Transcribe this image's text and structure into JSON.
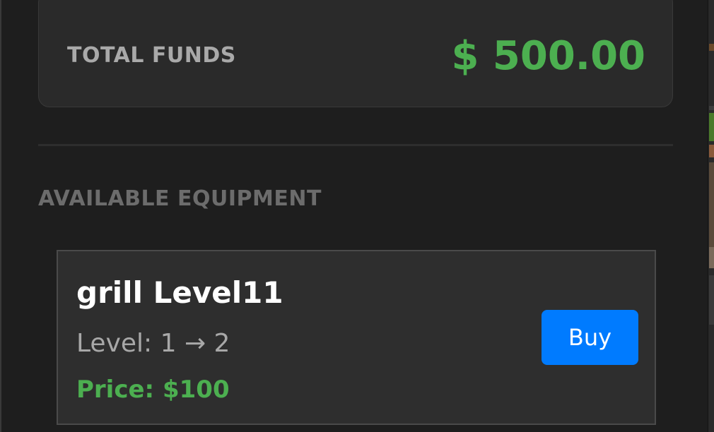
{
  "funds": {
    "label": "TOTAL FUNDS",
    "value": "$ 500.00"
  },
  "equipment": {
    "section_title": "AVAILABLE EQUIPMENT",
    "items": [
      {
        "name": "grill Level11",
        "level": "Level: 1 → 2",
        "price": "Price: $100",
        "buy_label": "Buy"
      }
    ]
  },
  "colors": {
    "background": "#1e1e1e",
    "card": "#2a2a2a",
    "accent_green": "#4caf50",
    "button_blue": "#007bff",
    "label_gray": "#a9a9a9",
    "section_gray": "#6c6c6c"
  }
}
